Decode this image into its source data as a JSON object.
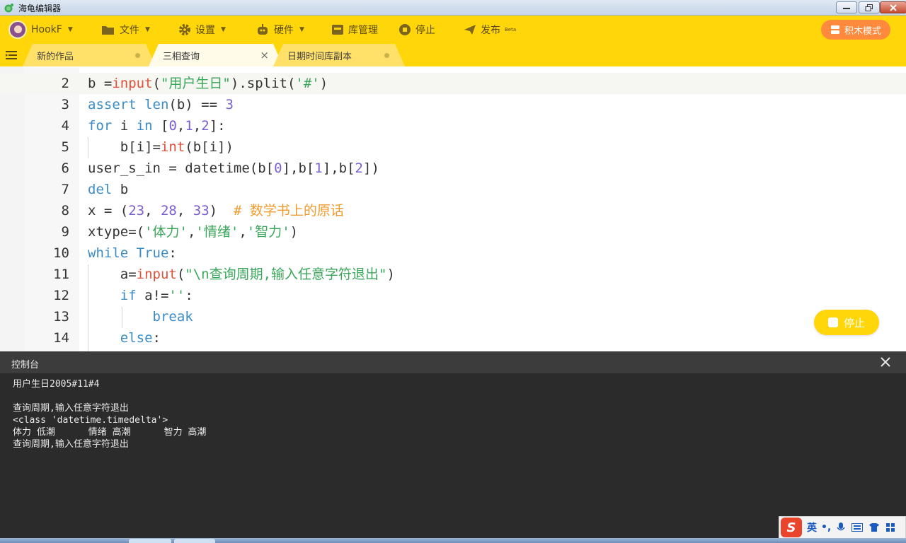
{
  "window": {
    "title": "海龟编辑器"
  },
  "toolbar": {
    "user": "HookF",
    "file": "文件",
    "settings": "设置",
    "hardware": "硬件",
    "library": "库管理",
    "stop": "停止",
    "publish": "发布",
    "publish_badge": "Beta",
    "blocks_mode": "积木模式"
  },
  "tabs": [
    {
      "label": "新的作品"
    },
    {
      "label": "三相查询"
    },
    {
      "label": "日期时间库副本"
    }
  ],
  "editor": {
    "lines": [
      {
        "n": "2",
        "text": "b =input(\"用户生日\").split('#')"
      },
      {
        "n": "3",
        "text": "assert len(b) == 3"
      },
      {
        "n": "4",
        "text": "for i in [0,1,2]:"
      },
      {
        "n": "5",
        "text": "    b[i]=int(b[i])"
      },
      {
        "n": "6",
        "text": "user_s_in = datetime(b[0],b[1],b[2])"
      },
      {
        "n": "7",
        "text": "del b"
      },
      {
        "n": "8",
        "text": "x = (23, 28, 33)  # 数学书上的原话"
      },
      {
        "n": "9",
        "text": "xtype=('体力','情绪','智力')"
      },
      {
        "n": "10",
        "text": "while True:"
      },
      {
        "n": "11",
        "text": "    a=input(\"\\n查询周期,输入任意字符退出\")"
      },
      {
        "n": "12",
        "text": "    if a!='':"
      },
      {
        "n": "13",
        "text": "        break"
      },
      {
        "n": "14",
        "text": "    else:"
      }
    ],
    "stop_button": "停止"
  },
  "console": {
    "title": "控制台",
    "lines": [
      "用户生日2005#11#4",
      "",
      "查询周期,输入任意字符退出",
      "<class 'datetime.timedelta'>",
      "体力 低潮      情绪 高潮      智力 高潮",
      "查询周期,输入任意字符退出"
    ]
  },
  "ime": {
    "mode": "英"
  },
  "colors": {
    "accent": "#ffd60a",
    "blocks_button": "#ff8a3d",
    "console_bg": "#2b2b2b"
  }
}
